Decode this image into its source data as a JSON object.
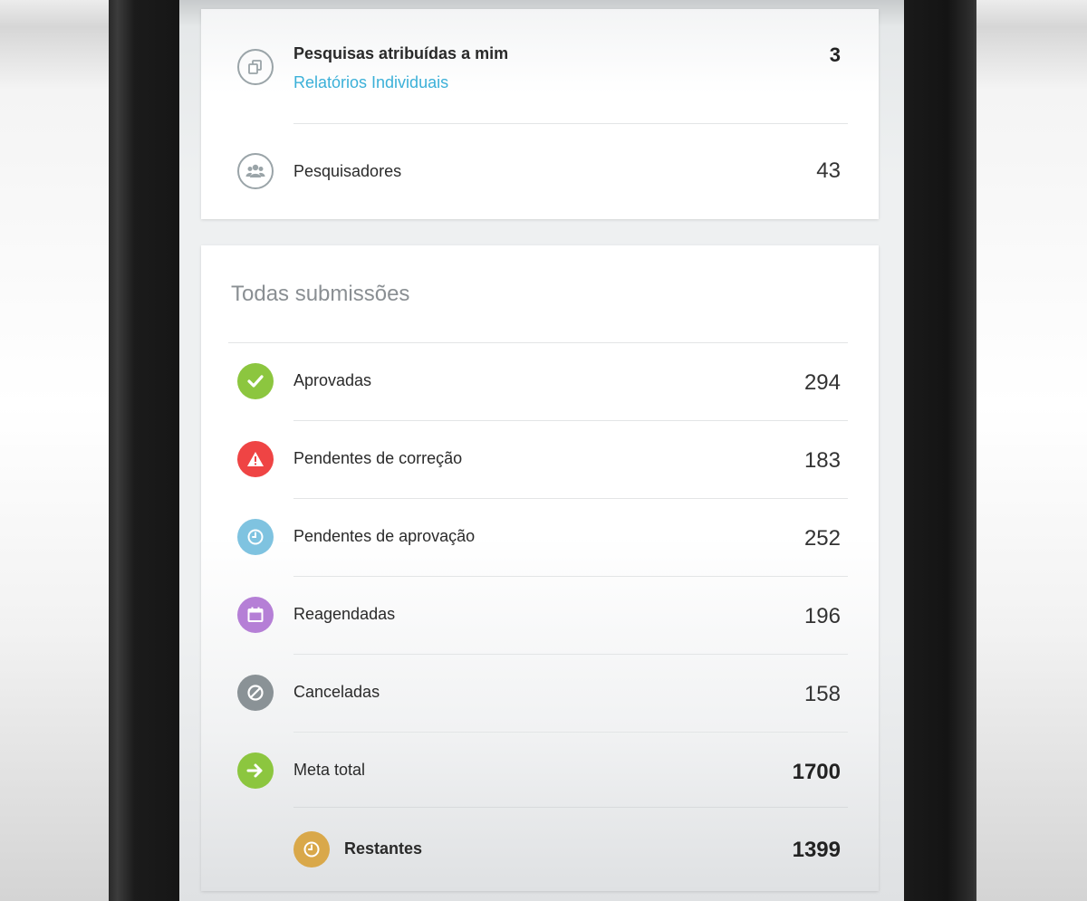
{
  "summary": {
    "assigned": {
      "title": "Pesquisas atribuídas a mim",
      "link": "Relatórios Individuais",
      "count": "3",
      "icon": "copy-icon"
    },
    "researchers": {
      "label": "Pesquisadores",
      "count": "43",
      "icon": "group-icon"
    }
  },
  "submissions": {
    "title": "Todas submissões",
    "rows": [
      {
        "label": "Aprovadas",
        "value": "294",
        "icon": "check-icon",
        "color": "#8cc63f"
      },
      {
        "label": "Pendentes de correção",
        "value": "183",
        "icon": "warning-icon",
        "color": "#ef4444"
      },
      {
        "label": "Pendentes de aprovação",
        "value": "252",
        "icon": "clock-icon",
        "color": "#7fc3e0"
      },
      {
        "label": "Reagendadas",
        "value": "196",
        "icon": "calendar-icon",
        "color": "#b57fd6"
      },
      {
        "label": "Canceladas",
        "value": "158",
        "icon": "ban-icon",
        "color": "#8a9296"
      },
      {
        "label": "Meta total",
        "value": "1700",
        "icon": "arrow-right-icon",
        "color": "#8cc63f"
      },
      {
        "label": "Restantes",
        "value": "1399",
        "icon": "clock-icon",
        "color": "#d9a84a"
      }
    ]
  }
}
